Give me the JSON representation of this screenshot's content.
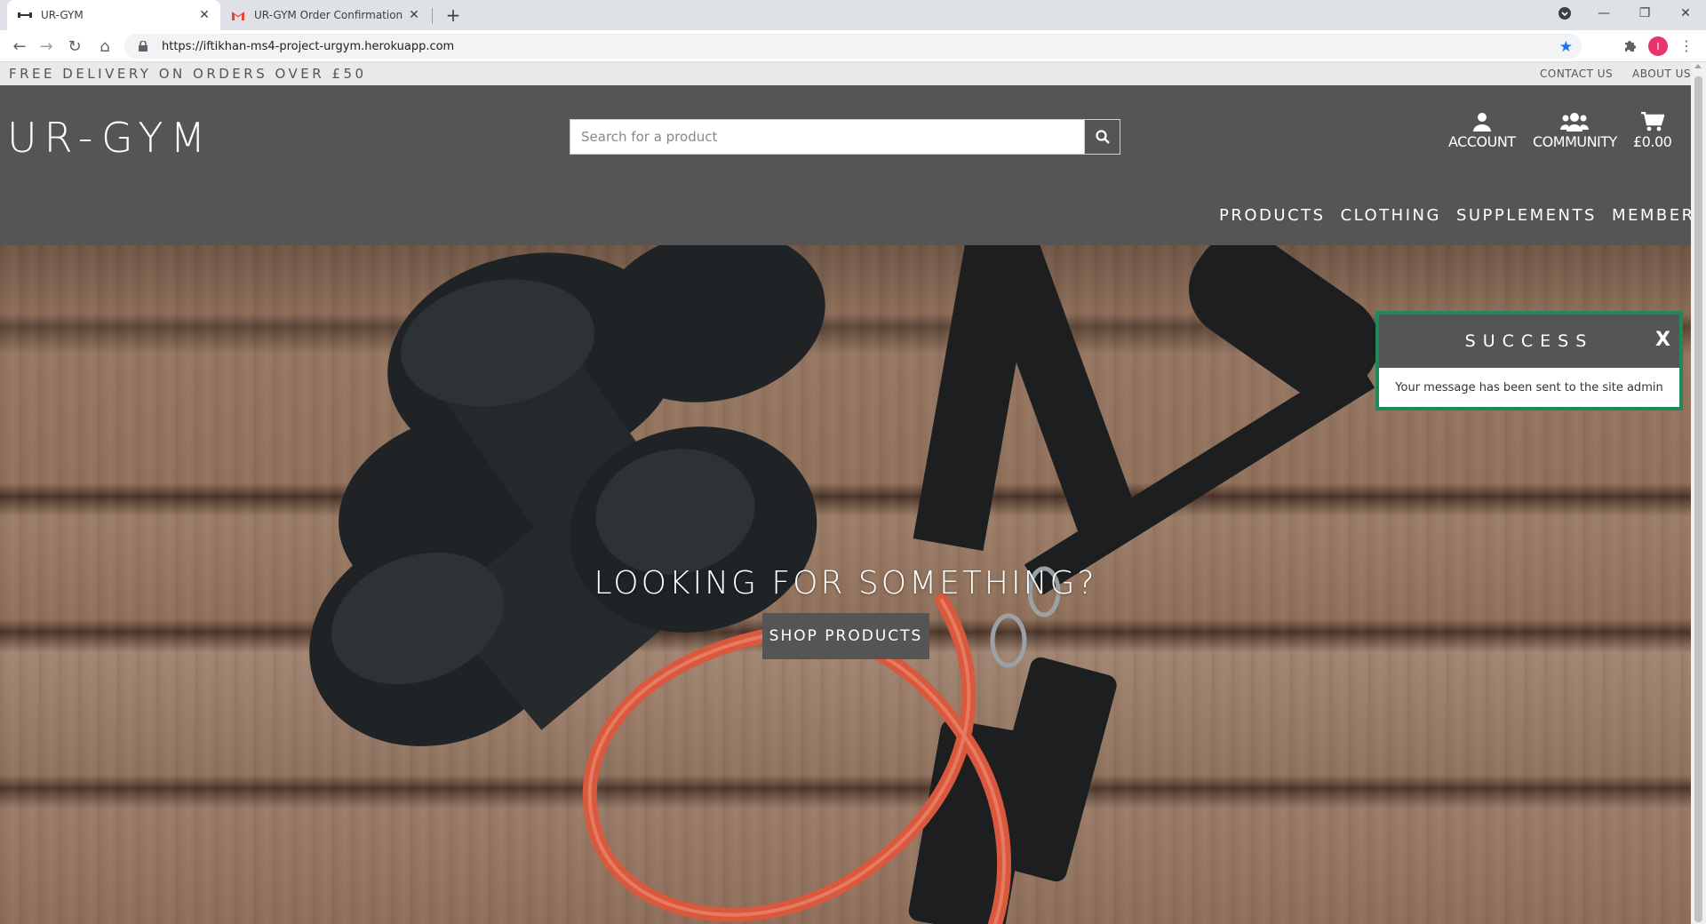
{
  "browser": {
    "tabs": [
      {
        "title": "UR-GYM",
        "favicon": "dumbbell-icon"
      },
      {
        "title": "UR-GYM Order Confirmation For",
        "favicon": "gmail-icon"
      }
    ],
    "url": "https://iftikhan-ms4-project-urgym.herokuapp.com",
    "profile_initial": "I"
  },
  "topbar": {
    "promo": "FREE DELIVERY ON ORDERS OVER £50",
    "contact": "CONTACT US",
    "about": "ABOUT US"
  },
  "header": {
    "logo": "UR-GYM",
    "search_placeholder": "Search for a product",
    "account_label": "ACCOUNT",
    "community_label": "COMMUNITY",
    "cart_label": "£0.00"
  },
  "nav": {
    "items": [
      "PRODUCTS",
      "CLOTHING",
      "SUPPLEMENTS",
      "MEMBERSHIPS"
    ]
  },
  "hero": {
    "title": "LOOKING FOR SOMETHING?",
    "button": "SHOP PRODUCTS",
    "slides": 4,
    "active_slide": 1
  },
  "toast": {
    "title": "SUCCESS",
    "close": "X",
    "message": "Your message has been sent to the site admin",
    "accent": "#1e8a5a"
  },
  "colors": {
    "header_bg": "#555555",
    "topbar_bg": "#e9e9e9"
  }
}
